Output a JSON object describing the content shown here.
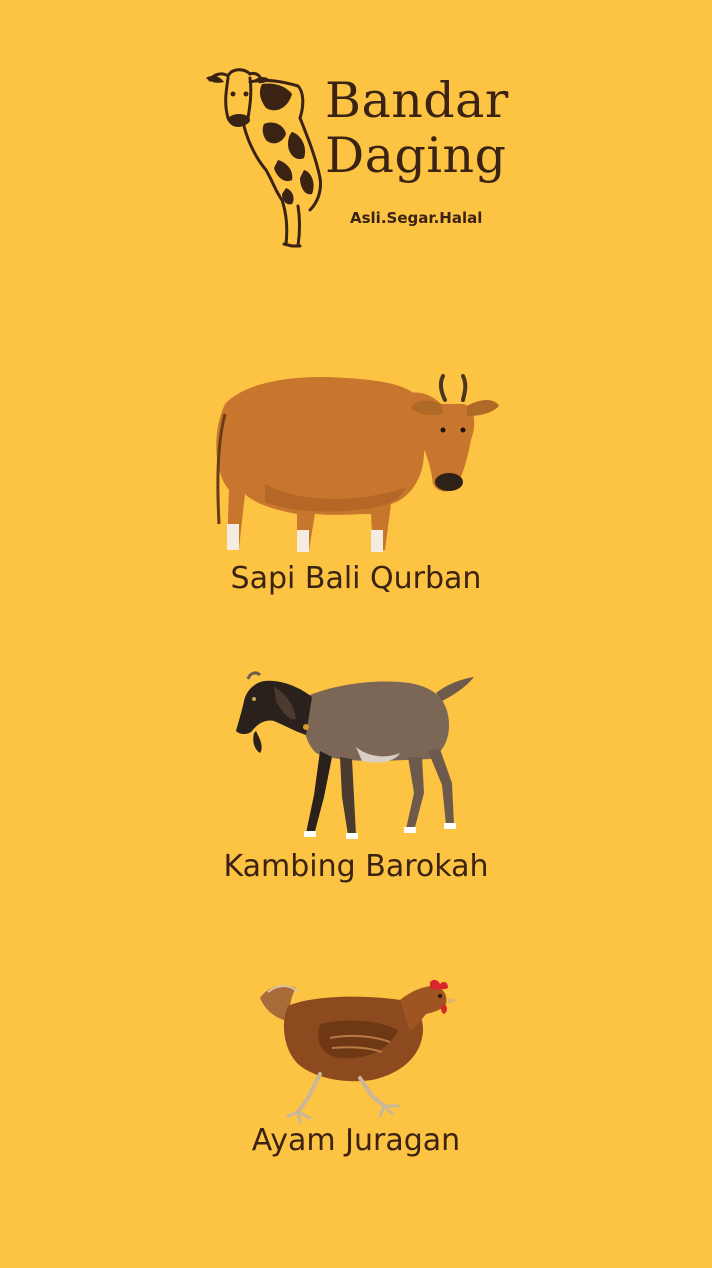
{
  "brand": {
    "name_line1": "Bandar",
    "name_line2": "Daging",
    "tagline": "Asli.Segar.Halal",
    "logo_icon": "cow-logo-icon"
  },
  "products": [
    {
      "label": "Sapi Bali Qurban",
      "image": "bali-cow-image"
    },
    {
      "label": "Kambing Barokah",
      "image": "goat-image"
    },
    {
      "label": "Ayam Juragan",
      "image": "chicken-image"
    }
  ],
  "colors": {
    "background": "#FDC342",
    "text": "#3B2314"
  }
}
